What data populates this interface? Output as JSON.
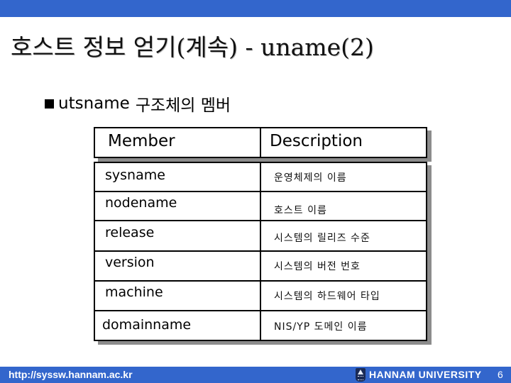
{
  "slide": {
    "title": "호스트 정보 얻기(계속) - uname(2)",
    "bullet": {
      "icon": "square-bullet-icon",
      "text_en": "utsname",
      "text_ko": "구조체의 멤버"
    }
  },
  "table": {
    "headers": {
      "member": "Member",
      "description": "Description"
    },
    "rows": [
      {
        "member": "sysname",
        "description": "운영체제의 이름"
      },
      {
        "member": "nodename",
        "description": "호스트 이름"
      },
      {
        "member": "release",
        "description": "시스템의 릴리즈 수준"
      },
      {
        "member": "version",
        "description": "시스템의 버전 번호"
      },
      {
        "member": "machine",
        "description": "시스템의 하드웨어 타입"
      },
      {
        "member": "domainname",
        "description": "NIS/YP 도메인 이름"
      }
    ]
  },
  "footer": {
    "url": "http://syssw.hannam.ac.kr",
    "logo_icon": "university-emblem-icon",
    "university": "HANNAM  UNIVERSITY",
    "page_number": "6"
  },
  "colors": {
    "banner": "#3366cc",
    "shadow": "#8c8c8c"
  }
}
